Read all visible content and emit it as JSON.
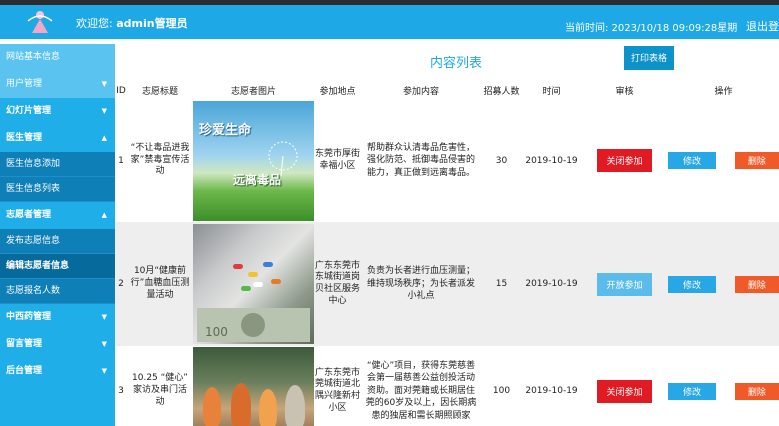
{
  "header": {
    "welcome_prefix": "欢迎您:",
    "username": "admin管理员",
    "time": "当前时间: 2023/10/18 09:09:28星期",
    "logout": "退出登录"
  },
  "sidebar": {
    "items": [
      {
        "label": "网站基本信息",
        "type": "top"
      },
      {
        "label": "用户管理",
        "type": "top",
        "arrow": "▼"
      },
      {
        "label": "幻灯片管理",
        "type": "group",
        "arrow": "▼"
      },
      {
        "label": "医生管理",
        "type": "group",
        "arrow": "▲"
      },
      {
        "label": "医生信息添加",
        "type": "sub"
      },
      {
        "label": "医生信息列表",
        "type": "sub"
      },
      {
        "label": "志愿者管理",
        "type": "group",
        "arrow": "▲"
      },
      {
        "label": "发布志愿信息",
        "type": "sub"
      },
      {
        "label": "编辑志愿者信息",
        "type": "sub-active"
      },
      {
        "label": "志愿报名人数",
        "type": "sub"
      },
      {
        "label": "中西药管理",
        "type": "group",
        "arrow": "▼"
      },
      {
        "label": "留言管理",
        "type": "group",
        "arrow": "▼"
      },
      {
        "label": "后台管理",
        "type": "group",
        "arrow": "▼"
      }
    ]
  },
  "main": {
    "title": "内容列表",
    "print_label": "打印表格",
    "columns": [
      "ID",
      "志愿标题",
      "志愿者图片",
      "参加地点",
      "参加内容",
      "招募人数",
      "时间",
      "审核",
      "操作"
    ],
    "rows": [
      {
        "id": "1",
        "title": "“不让毒品进我家”禁毒宣传活动",
        "image_text_1": "珍爱生命",
        "image_text_2": "远离毒品",
        "place": "东莞市厚街幸福小区",
        "content": "帮助群众认清毒品危害性，强化防范、抵御毒品侵害的能力，真正做到远离毒品。",
        "count": "30",
        "time": "2019-10-19",
        "audit": "关闭参加",
        "edit": "修改",
        "delete": "删除"
      },
      {
        "id": "2",
        "title": "10月“健康前行”血糖血压测量活动",
        "place": "广东东莞市东城街道岗贝社区服务中心",
        "content": "负责为长者进行血压测量；维持现场秩序；为长者派发小礼点",
        "count": "15",
        "time": "2019-10-19",
        "audit": "开放参加",
        "edit": "修改",
        "delete": "删除"
      },
      {
        "id": "3",
        "title": "10.25 “健心” 家访及串门活动",
        "place": "广东东莞市莞城街道北隅兴隆新村小区",
        "content": "“健心”项目，获得东莞慈善会第一届慈善公益创投活动资助。面对莞籍或长期居住莞的60岁及以上，因长期病患的独居和需长期照顾家",
        "count": "100",
        "time": "2019-10-19",
        "audit": "关闭参加",
        "edit": "修改",
        "delete": "删除"
      }
    ]
  },
  "colors": {
    "header_bg": "#1ea8e6",
    "sidebar_bg": "#20aee9",
    "close_red": "#e11b24",
    "open_blue": "#5bbcec",
    "edit_blue": "#27a7e6",
    "delete_orange": "#f05a28"
  }
}
